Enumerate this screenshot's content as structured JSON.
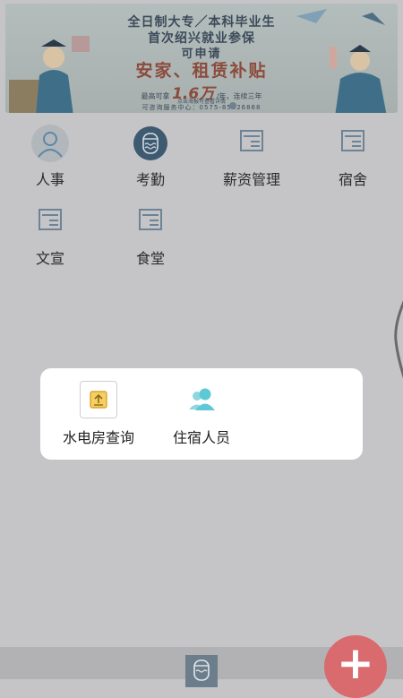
{
  "banner": {
    "line1": "全日制大专／本科毕业生",
    "line2": "首次绍兴就业参保",
    "line3": "可申请",
    "line4": "安家、租赁补贴",
    "line5_pre": "最高可拿",
    "line5_big": "1.6万",
    "line5_post": "/年，连续三年",
    "line6": "点击海报可查看详情",
    "line7": "可咨询服务中心：0575-85626868"
  },
  "menu": [
    {
      "label": "人事",
      "icon": "person-icon"
    },
    {
      "label": "考勤",
      "icon": "attendance-icon"
    },
    {
      "label": "薪资管理",
      "icon": "document-icon"
    },
    {
      "label": "宿舍",
      "icon": "document-icon"
    },
    {
      "label": "文宣",
      "icon": "document-icon"
    },
    {
      "label": "食堂",
      "icon": "document-icon"
    }
  ],
  "popup": {
    "items": [
      {
        "label": "水电房查询",
        "icon": "upload-icon"
      },
      {
        "label": "住宿人员",
        "icon": "people-icon"
      }
    ]
  },
  "fab": {
    "label": "+"
  },
  "colors": {
    "accent": "#d96a6d",
    "icon": "#6d8396",
    "overlay": "#c5c5c7"
  }
}
